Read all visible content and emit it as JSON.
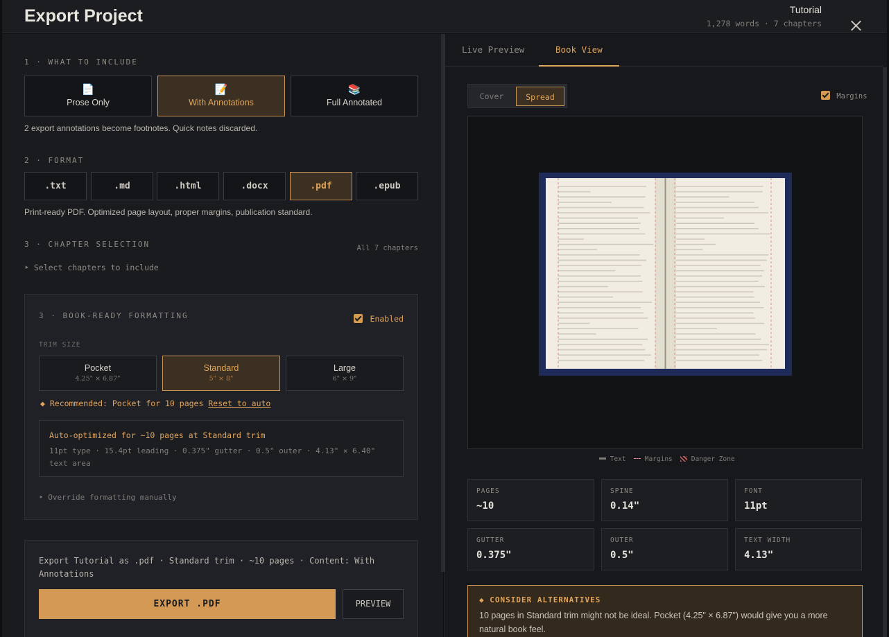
{
  "header": {
    "title": "Export Project",
    "project_name": "Tutorial",
    "project_meta": "1,278 words · 7 chapters"
  },
  "include": {
    "heading": "1 · WHAT TO INCLUDE",
    "options": [
      {
        "icon": "📄",
        "icon_name": "page-icon",
        "label": "Prose Only"
      },
      {
        "icon": "📝",
        "icon_name": "memo-icon",
        "label": "With Annotations"
      },
      {
        "icon": "📚",
        "icon_name": "books-icon",
        "label": "Full Annotated"
      }
    ],
    "selected": "With Annotations",
    "note": "2 export annotations become footnotes. Quick notes discarded."
  },
  "format": {
    "heading": "2 · FORMAT",
    "options": [
      ".txt",
      ".md",
      ".html",
      ".docx",
      ".pdf",
      ".epub"
    ],
    "selected": ".pdf",
    "note": "Print-ready PDF. Optimized page layout, proper margins, publication standard."
  },
  "chapters": {
    "heading": "3 · CHAPTER SELECTION",
    "count_label": "All 7 chapters",
    "disclosure": "‣ Select chapters to include"
  },
  "book": {
    "heading": "3 · BOOK-READY FORMATTING",
    "enabled_label": "Enabled",
    "enabled": true,
    "trim_heading": "TRIM SIZE",
    "trims": [
      {
        "label": "Pocket",
        "size": "4.25\" × 6.87\""
      },
      {
        "label": "Standard",
        "size": "5\" × 8\""
      },
      {
        "label": "Large",
        "size": "6\" × 9\""
      }
    ],
    "selected_trim": "Standard",
    "recommend_text": "◆ Recommended: Pocket for 10 pages",
    "reset_link": "Reset to auto",
    "auto_title": "Auto-optimized for ~10 pages at Standard trim",
    "auto_detail": "11pt type · 15.4pt leading · 0.375\" gutter · 0.5\" outer · 4.13\" × 6.40\" text area",
    "override": "‣ Override formatting manually"
  },
  "export": {
    "summary": "Export Tutorial as .pdf · Standard trim · ~10 pages · Content: With Annotations",
    "export_label": "EXPORT .PDF",
    "preview_label": "PREVIEW"
  },
  "preview": {
    "tabs": [
      "Live Preview",
      "Book View"
    ],
    "active_tab": "Book View",
    "view_modes": [
      "Cover",
      "Spread"
    ],
    "active_mode": "Spread",
    "margins_label": "Margins",
    "margins_checked": true,
    "legend": [
      "Text",
      "Margins",
      "Danger Zone"
    ],
    "colors": {
      "cover": "#1e2b5a",
      "paper": "#f1ede2",
      "text_line": "#cfcabe",
      "margin_guide": "#e08a8a",
      "accent": "#e1a55b"
    }
  },
  "stats": [
    {
      "key": "PAGES",
      "value": "~10"
    },
    {
      "key": "SPINE",
      "value": "0.14\""
    },
    {
      "key": "FONT",
      "value": "11pt"
    },
    {
      "key": "GUTTER",
      "value": "0.375\""
    },
    {
      "key": "OUTER",
      "value": "0.5\""
    },
    {
      "key": "TEXT WIDTH",
      "value": "4.13\""
    }
  ],
  "alternatives": {
    "title": "◆ CONSIDER ALTERNATIVES",
    "text": "10 pages in Standard trim might not be ideal. Pocket (4.25\" × 6.87\") would give you a more natural book feel."
  }
}
